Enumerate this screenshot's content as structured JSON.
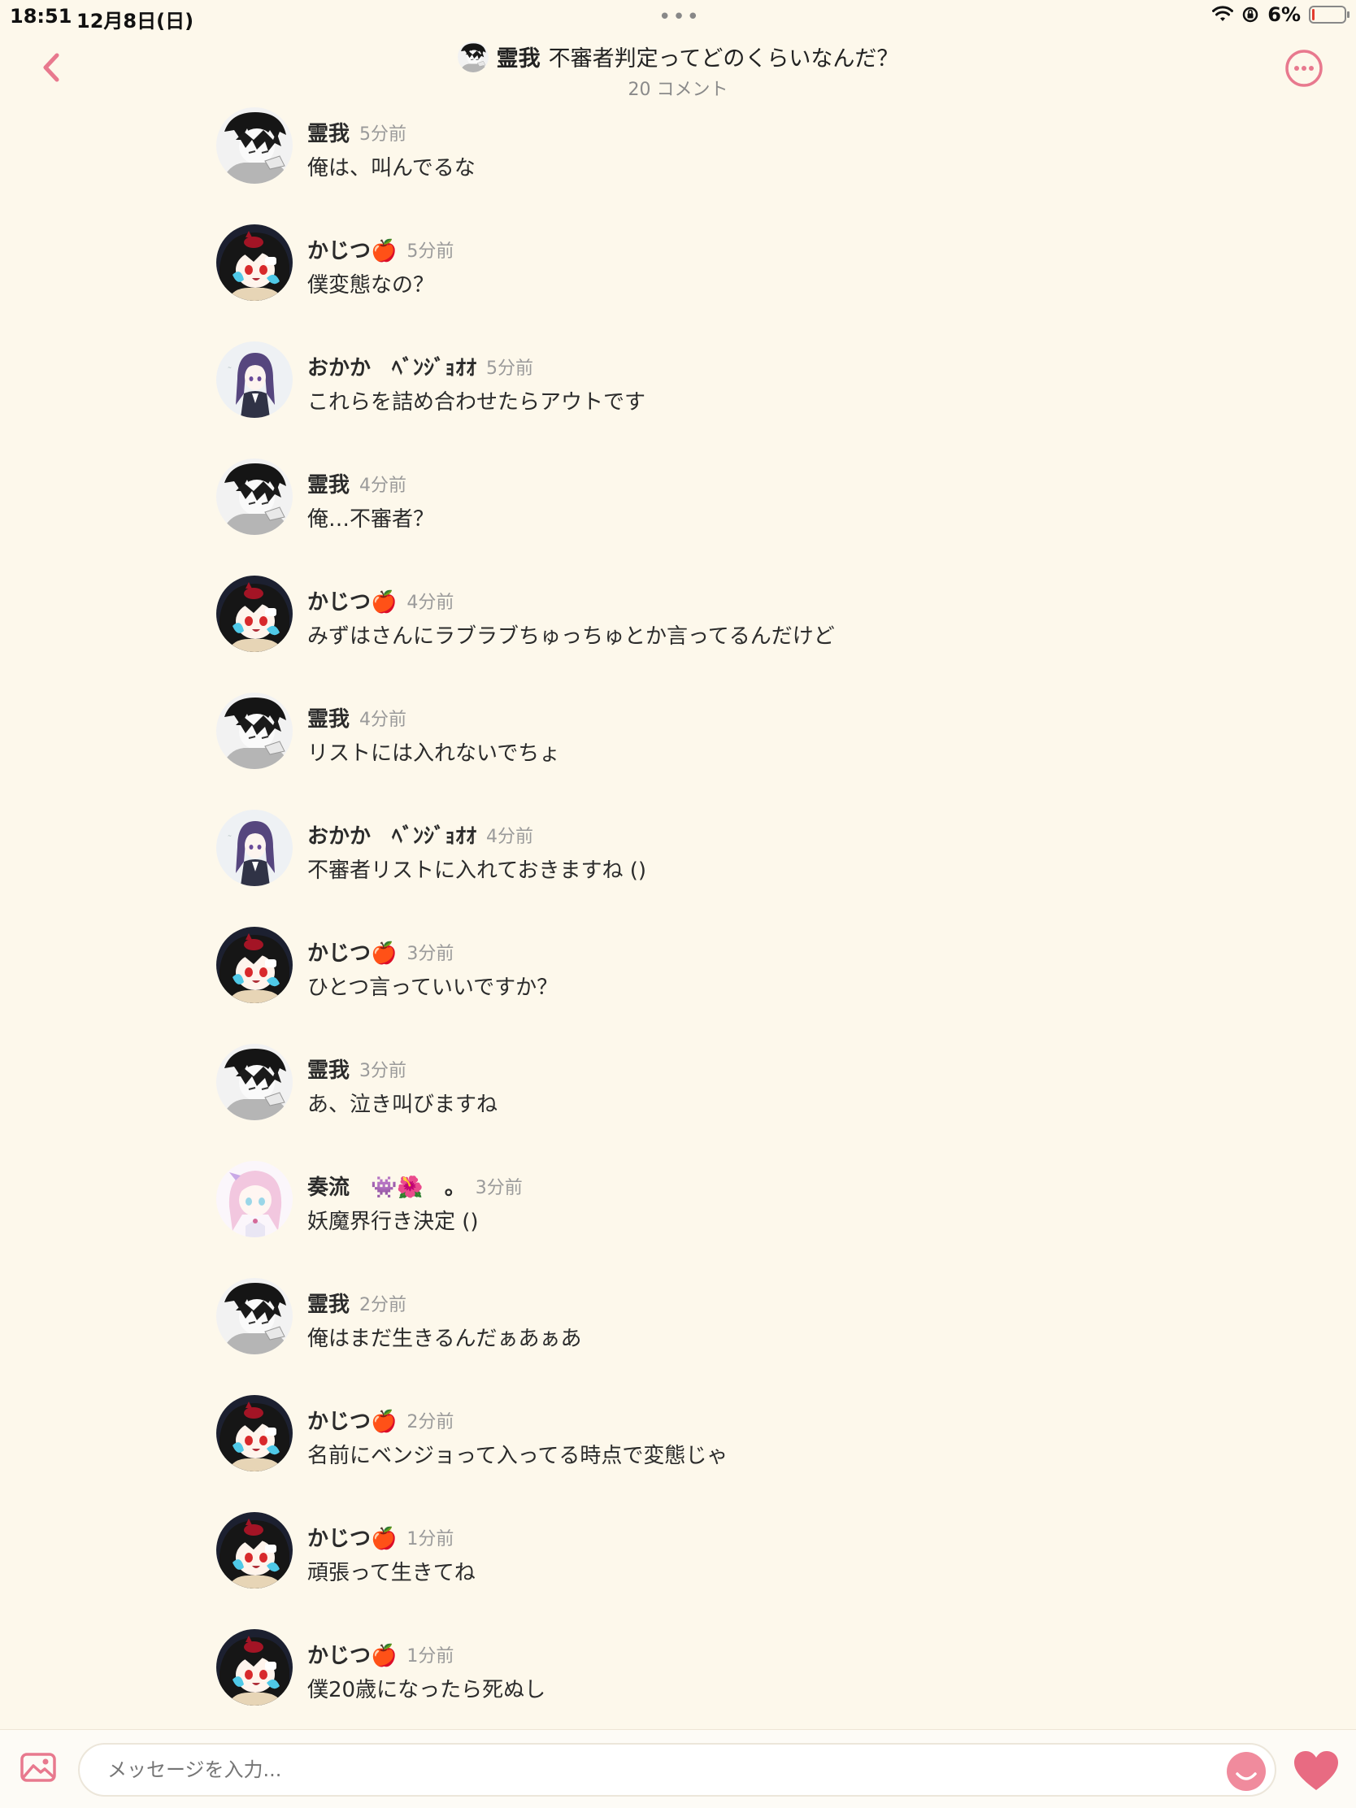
{
  "status_bar": {
    "time": "18:51",
    "date": "12月8日(日)",
    "dots": "•••",
    "battery_pct": "6%",
    "battery_level": 0.06
  },
  "header": {
    "author": "霊我",
    "title": "不審者判定ってどのくらいなんだ？",
    "subtitle": "20 コメント"
  },
  "comments": [
    {
      "name": "霊我",
      "time": "5分前",
      "text": "俺は、叫んでるな",
      "avatar": "reiga"
    },
    {
      "name": "かじつ🍎",
      "time": "5分前",
      "text": "僕変態なの？",
      "avatar": "kajitsu"
    },
    {
      "name": "おかか　ﾍﾞﾝｼﾞｮｵｵ",
      "time": "5分前",
      "text": "これらを詰め合わせたらアウトです",
      "avatar": "okaka"
    },
    {
      "name": "霊我",
      "time": "4分前",
      "text": "俺…不審者？",
      "avatar": "reiga"
    },
    {
      "name": "かじつ🍎",
      "time": "4分前",
      "text": "みずはさんにラブラブちゅっちゅとか言ってるんだけど",
      "avatar": "kajitsu"
    },
    {
      "name": "霊我",
      "time": "4分前",
      "text": "リストには入れないでちょ",
      "avatar": "reiga"
    },
    {
      "name": "おかか　ﾍﾞﾝｼﾞｮｵｵ",
      "time": "4分前",
      "text": "不審者リストに入れておきますね ()",
      "avatar": "okaka"
    },
    {
      "name": "かじつ🍎",
      "time": "3分前",
      "text": "ひとつ言っていいですか？",
      "avatar": "kajitsu"
    },
    {
      "name": "霊我",
      "time": "3分前",
      "text": "あ、泣き叫びますね",
      "avatar": "reiga"
    },
    {
      "name": "奏流　👾🌺　。",
      "time": "3分前",
      "text": "妖魔界行き決定 ()",
      "avatar": "kanaru"
    },
    {
      "name": "霊我",
      "time": "2分前",
      "text": "俺はまだ生きるんだぁあぁあ",
      "avatar": "reiga"
    },
    {
      "name": "かじつ🍎",
      "time": "2分前",
      "text": "名前にベンジョって入ってる時点で変態じゃ",
      "avatar": "kajitsu"
    },
    {
      "name": "かじつ🍎",
      "time": "1分前",
      "text": "頑張って生きてね",
      "avatar": "kajitsu"
    },
    {
      "name": "かじつ🍎",
      "time": "1分前",
      "text": "僕20歳になったら死ぬし",
      "avatar": "kajitsu"
    }
  ],
  "input": {
    "placeholder": "メッセージを入力..."
  },
  "icons": {
    "back": "chevron-left-icon",
    "more": "more-options-icon",
    "image": "image-icon",
    "emoji": "emoji-icon",
    "like": "heart-icon"
  },
  "colors": {
    "accent": "#e8798e",
    "background": "#fdf8eb",
    "heart": "#e86b82"
  }
}
